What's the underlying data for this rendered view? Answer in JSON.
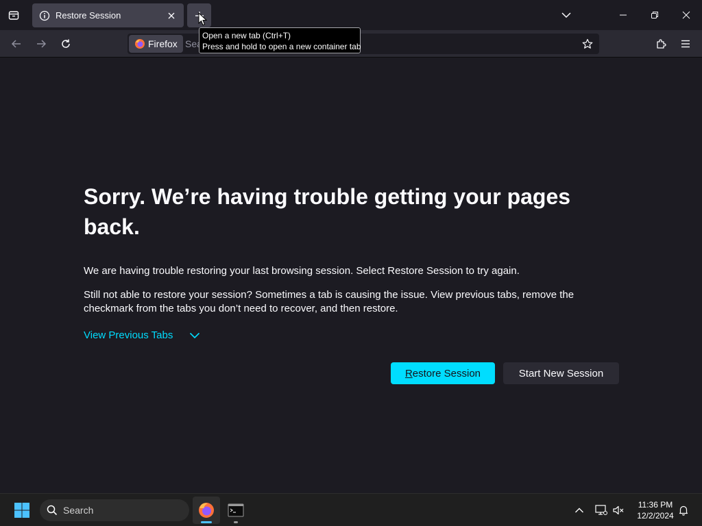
{
  "browser": {
    "tab_title": "Restore Session",
    "tooltip_line1": "Open a new tab (Ctrl+T)",
    "tooltip_line2": "Press and hold to open a new container tab",
    "search_engine": "Firefox",
    "url_placeholder": "Search or enter address"
  },
  "page": {
    "heading": "Sorry. We’re having trouble getting your pages back.",
    "paragraph1": "We are having trouble restoring your last browsing session. Select Restore Session to try again.",
    "paragraph2": "Still not able to restore your session? Sometimes a tab is causing the issue. View previous tabs, remove the checkmark from the tabs you don’t need to recover, and then restore.",
    "view_previous_tabs": "View Previous Tabs",
    "restore_button": "Restore Session",
    "new_session_button": "Start New Session"
  },
  "taskbar": {
    "search_label": "Search",
    "time": "11:36 PM",
    "date": "12/2/2024"
  },
  "colors": {
    "accent": "#00ddff",
    "background": "#1c1b22",
    "tab_active": "#42414d"
  }
}
